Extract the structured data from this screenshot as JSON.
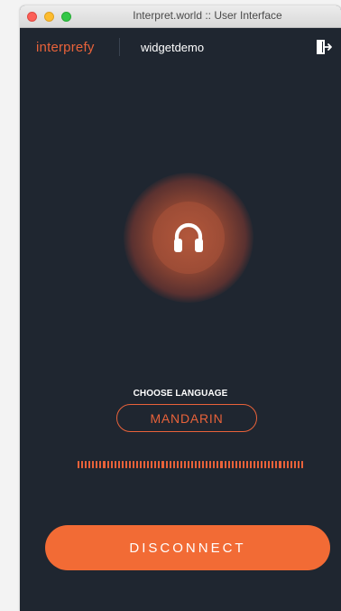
{
  "window": {
    "title": "Interpret.world :: User Interface"
  },
  "header": {
    "brand": "interprefy",
    "room_name": "widgetdemo",
    "logout_icon": "logout-icon"
  },
  "main": {
    "listen_icon": "headphones-icon",
    "choose_language_label": "CHOOSE LANGUAGE",
    "selected_language": "MANDARIN",
    "audio_level": 1.0,
    "disconnect_label": "DISCONNECT"
  },
  "colors": {
    "background": "#1f2630",
    "accent": "#e8623a",
    "button": "#f26b35",
    "text": "#ffffff"
  }
}
